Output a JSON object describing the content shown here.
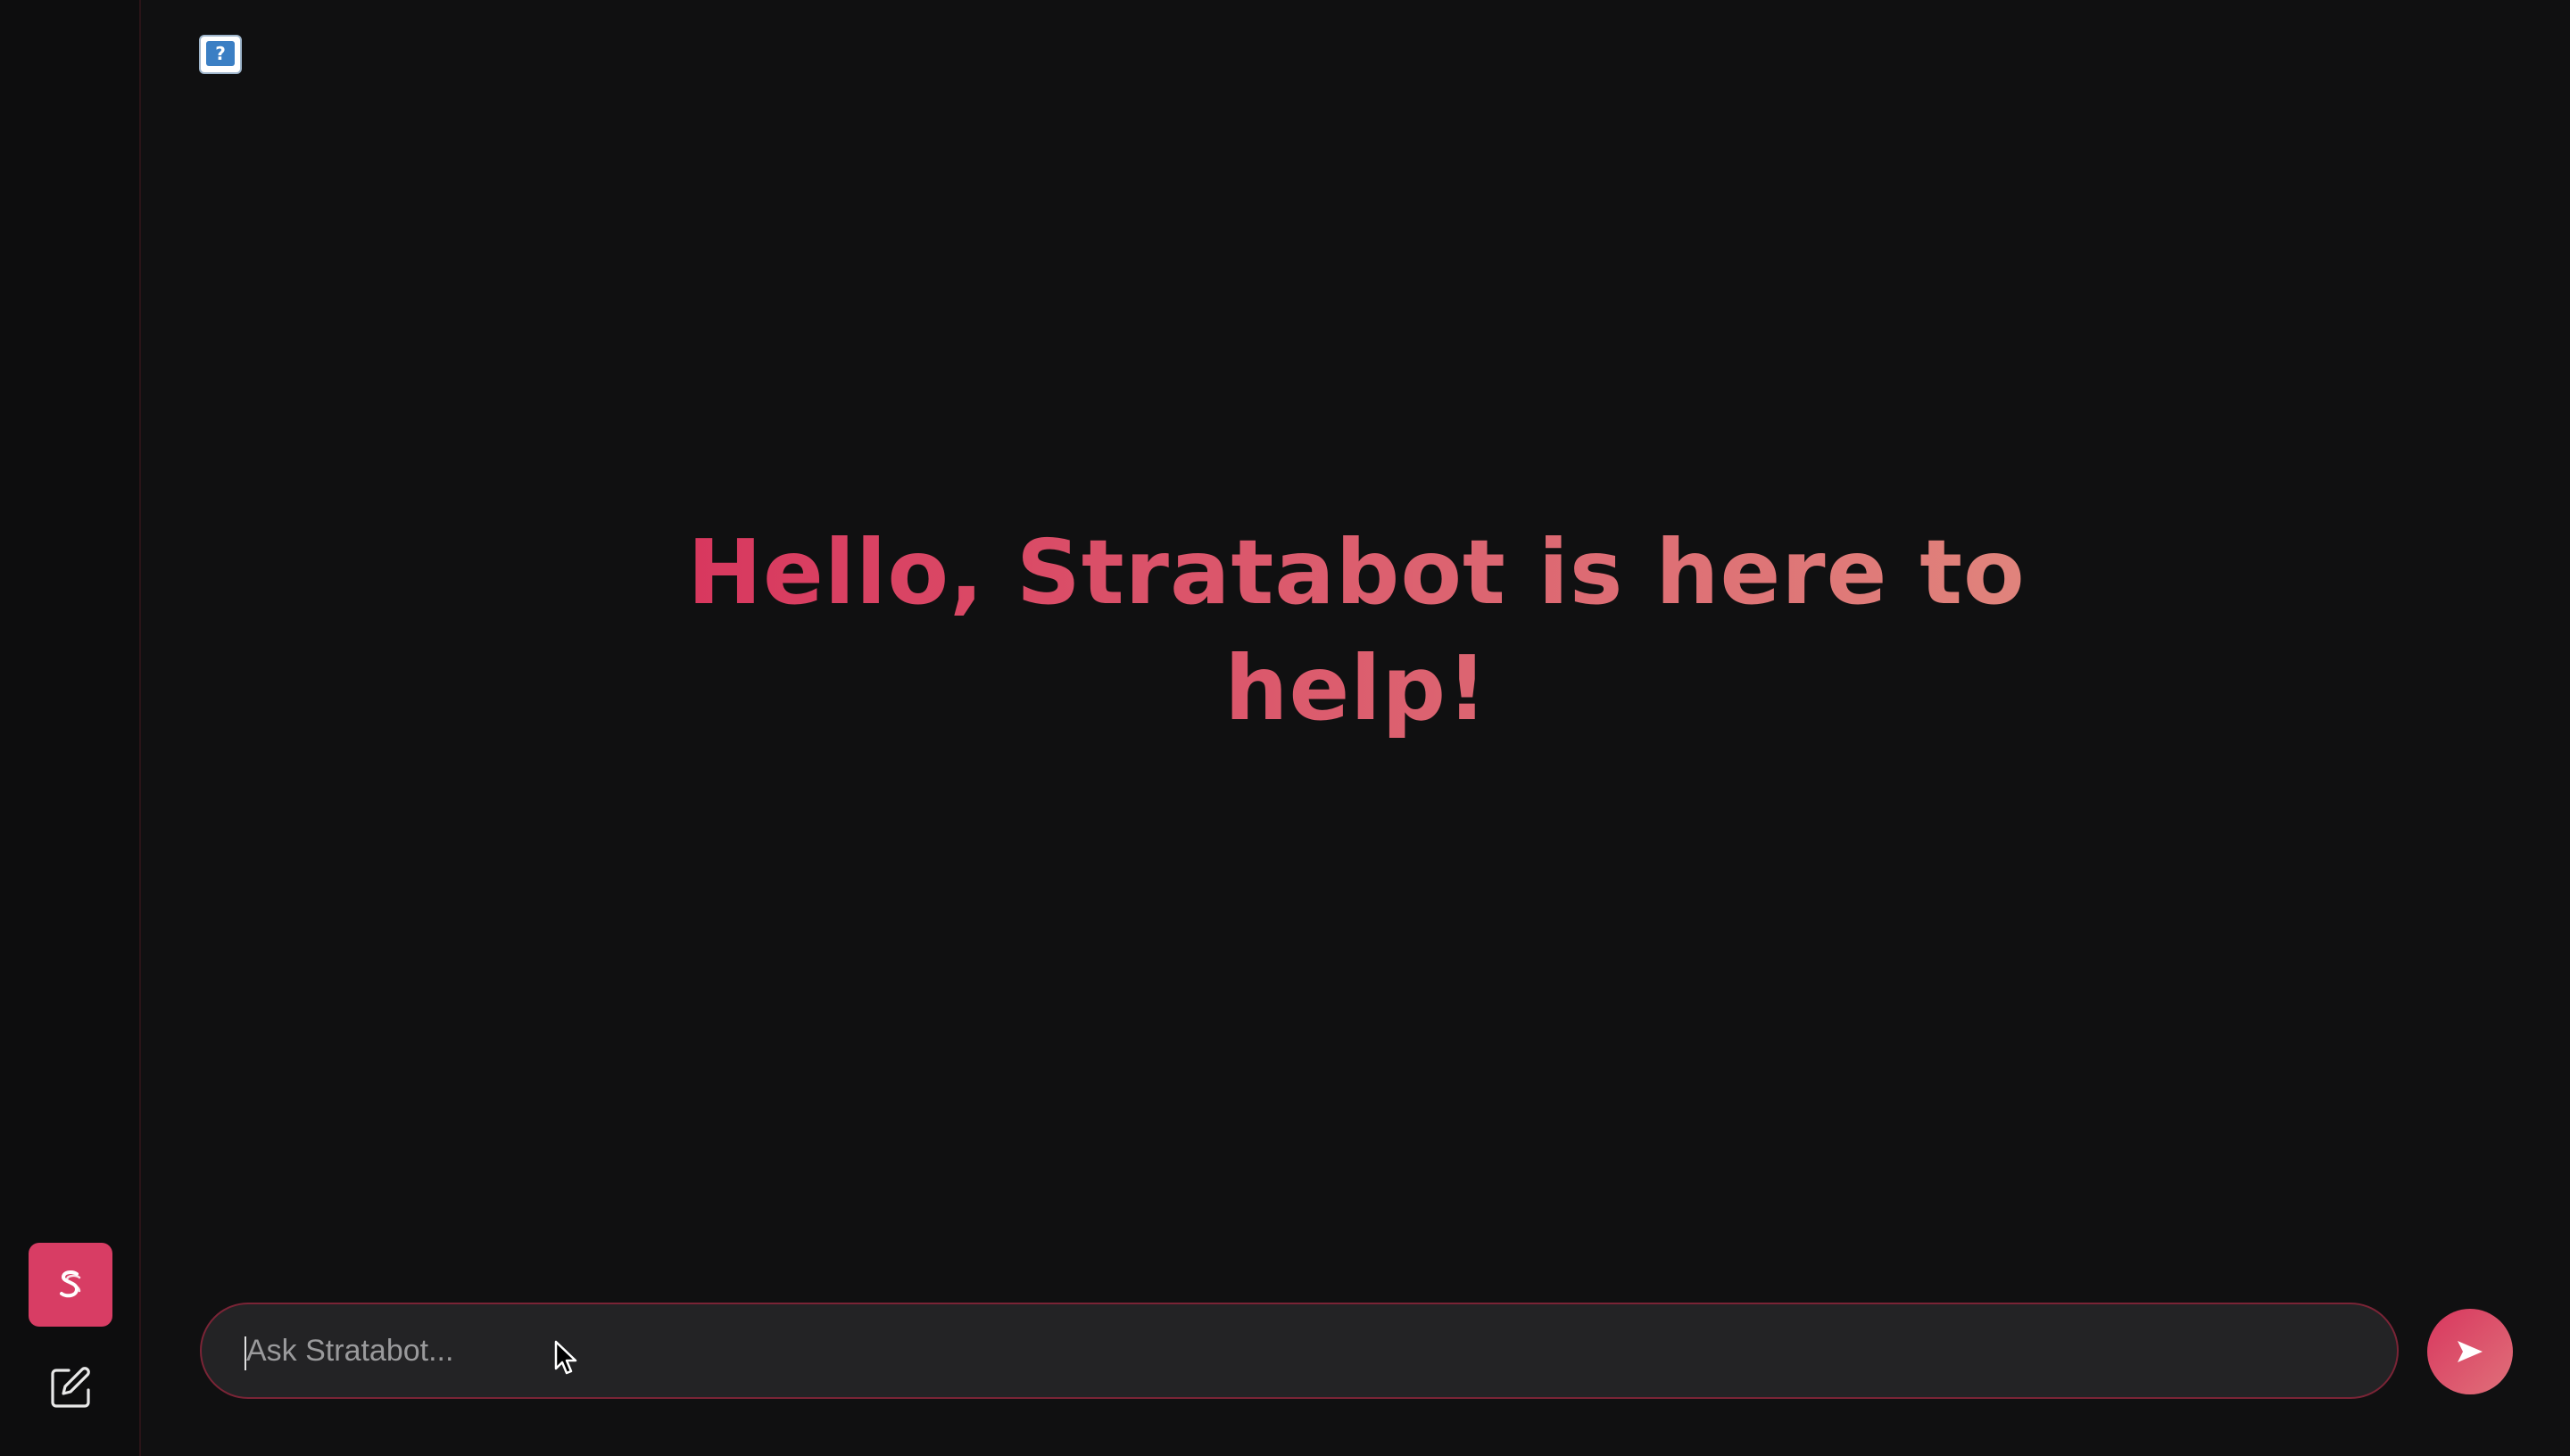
{
  "sidebar": {
    "brand_icon": "stratabot-logo-icon",
    "new_chat_icon": "edit-icon"
  },
  "header": {
    "image_icon": "broken-image-icon"
  },
  "main": {
    "greeting": "Hello, Stratabot is here to help!"
  },
  "composer": {
    "placeholder": "Ask Stratabot...",
    "value": "",
    "send_icon": "send-arrow-icon"
  },
  "colors": {
    "background": "#101011",
    "accent": "#d83d64",
    "accent_light": "#e0847c",
    "input_background": "#232325",
    "input_border": "#7a2436"
  }
}
